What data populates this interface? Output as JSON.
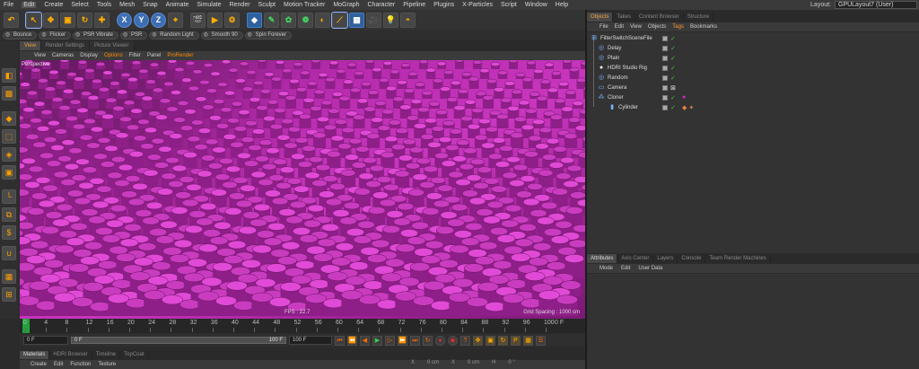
{
  "menu": {
    "items": [
      "File",
      "Edit",
      "Create",
      "Select",
      "Tools",
      "Mesh",
      "Snap",
      "Animate",
      "Simulate",
      "Render",
      "Sculpt",
      "Motion Tracker",
      "MoGraph",
      "Character",
      "Pipeline",
      "Plugins",
      "X-Particles",
      "Script",
      "Window",
      "Help"
    ],
    "layout_label": "Layout:",
    "layout_value": "GPULayout7 (User)"
  },
  "toolbar": {
    "undo_icon": "undo-icon",
    "x_label": "X",
    "y_label": "Y",
    "z_label": "Z"
  },
  "presets": [
    "Bounce",
    "Flicker",
    "PSR Vibrate",
    "PSR",
    "Random Light",
    "Smooth 90",
    "Spin Forever"
  ],
  "viewport_tabs": [
    "View",
    "Render Settings",
    "Picture Viewer"
  ],
  "viewport_menu": [
    "View",
    "Cameras",
    "Display",
    "Options",
    "Filter",
    "Panel",
    "ProRender"
  ],
  "viewport": {
    "label": "Perspective",
    "fps": "FPS : 22.7",
    "grid": "Grid Spacing : 1000 cm",
    "accent": "#c936bf"
  },
  "timeline": {
    "ticks": [
      "0",
      "4",
      "8",
      "12",
      "16",
      "20",
      "24",
      "28",
      "32",
      "36",
      "40",
      "44",
      "48",
      "52",
      "56",
      "60",
      "64",
      "68",
      "72",
      "76",
      "80",
      "84",
      "88",
      "92",
      "96",
      "100"
    ],
    "current_frame": "0",
    "end_label": "0 F"
  },
  "transport": {
    "start": "0 F",
    "range_start": "0 F",
    "range_end": "100 F",
    "end": "100 F"
  },
  "materials": {
    "tabs": [
      "Materials",
      "HDRI Browser",
      "Timeline",
      "TopCoat"
    ],
    "menu": [
      "Create",
      "Edit",
      "Function",
      "Texture"
    ],
    "coords": [
      "X",
      "0 cm",
      "X",
      "0 cm",
      "H",
      "0 °"
    ]
  },
  "objects": {
    "tabs": [
      "Objects",
      "Takes",
      "Content Browser",
      "Structure"
    ],
    "menu": [
      "File",
      "Edit",
      "View",
      "Objects",
      "Tags",
      "Bookmarks"
    ],
    "items": [
      {
        "name": "FilterSwitchSceneFile",
        "icon": "scene-icon"
      },
      {
        "name": "Delay",
        "icon": "effector-icon"
      },
      {
        "name": "Plain",
        "icon": "effector-icon"
      },
      {
        "name": "HDRI Studio Rig",
        "icon": "hdri-icon"
      },
      {
        "name": "Random",
        "icon": "effector-icon"
      },
      {
        "name": "Camera",
        "icon": "camera-icon"
      },
      {
        "name": "Cloner",
        "icon": "cloner-icon"
      },
      {
        "name": "Cylinder",
        "icon": "cylinder-icon"
      }
    ]
  },
  "attributes": {
    "tabs": [
      "Attributes",
      "Axis Center",
      "Layers",
      "Console",
      "Team Render Machines"
    ],
    "menu": [
      "Mode",
      "Edit",
      "User Data"
    ]
  }
}
